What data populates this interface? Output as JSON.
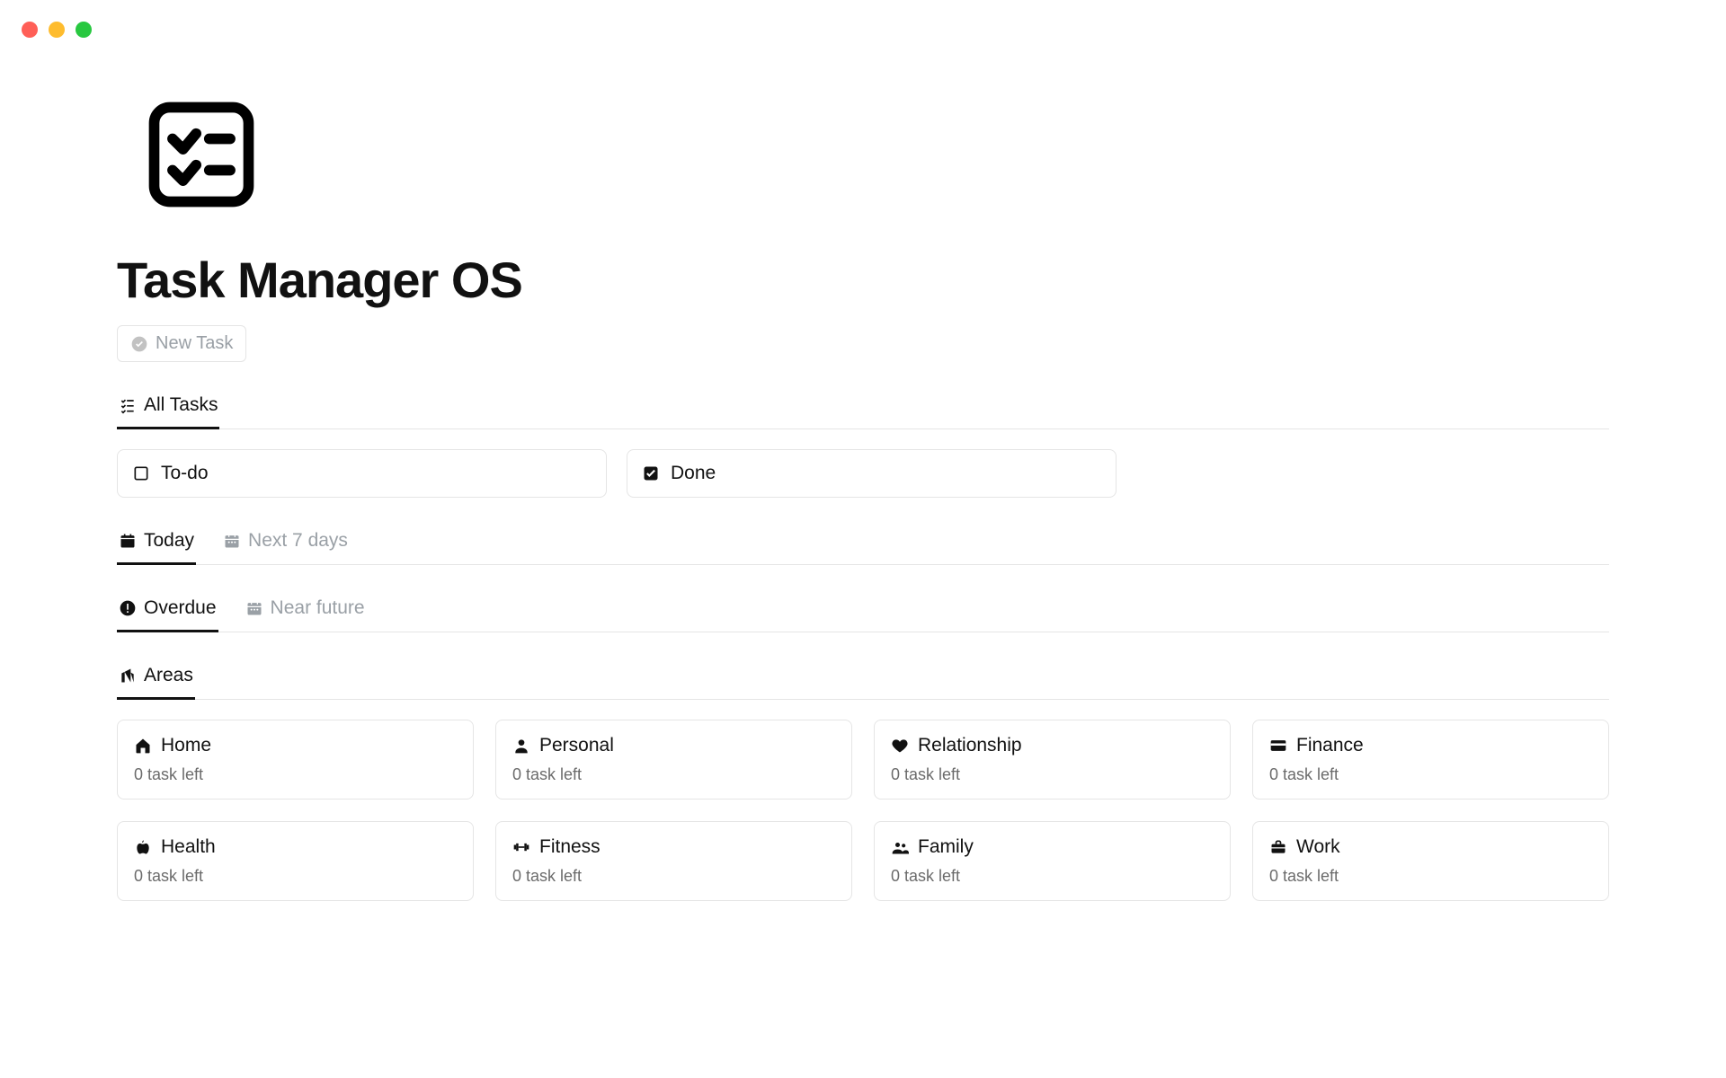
{
  "page": {
    "title": "Task Manager OS",
    "new_task_label": "New Task"
  },
  "tabs_all": {
    "all_tasks": "All Tasks"
  },
  "status": {
    "todo": "To-do",
    "done": "Done"
  },
  "tabs_day": {
    "today": "Today",
    "next7": "Next 7 days"
  },
  "tabs_over": {
    "overdue": "Overdue",
    "near_future": "Near future"
  },
  "tabs_areas": {
    "areas": "Areas"
  },
  "areas": [
    {
      "label": "Home",
      "sub": "0 task left",
      "icon": "house-icon"
    },
    {
      "label": "Personal",
      "sub": "0 task left",
      "icon": "person-icon"
    },
    {
      "label": "Relationship",
      "sub": "0 task left",
      "icon": "heart-icon"
    },
    {
      "label": "Finance",
      "sub": "0 task left",
      "icon": "credit-card-icon"
    },
    {
      "label": "Health",
      "sub": "0 task left",
      "icon": "apple-icon"
    },
    {
      "label": "Fitness",
      "sub": "0 task left",
      "icon": "dumbbell-icon"
    },
    {
      "label": "Family",
      "sub": "0 task left",
      "icon": "group-icon"
    },
    {
      "label": "Work",
      "sub": "0 task left",
      "icon": "briefcase-icon"
    }
  ]
}
